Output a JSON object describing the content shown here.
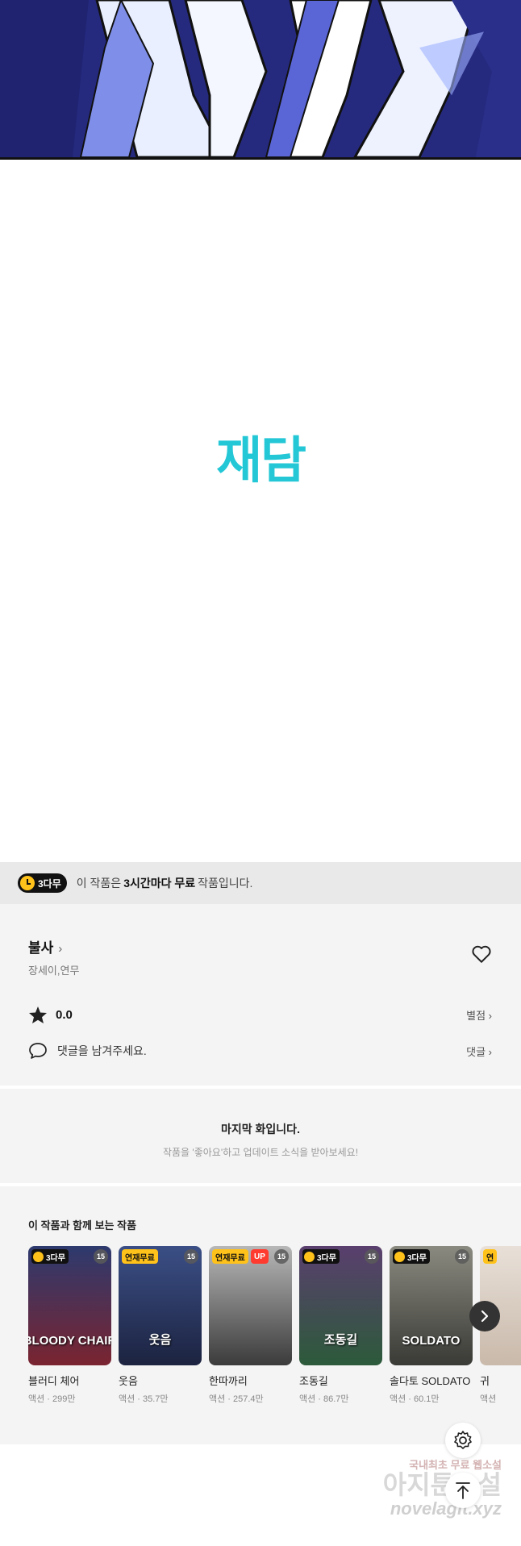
{
  "logo": {
    "text": "재담"
  },
  "free_bar": {
    "badge": "3다무",
    "text_pre": "이 작품은",
    "text_bold": "3시간마다 무료",
    "text_post": "작품입니다."
  },
  "work": {
    "title": "불사",
    "title_chevron": "›",
    "authors": "장세이,연무",
    "rating": "0.0",
    "rating_link": "별점 ›",
    "comment_placeholder": "댓글을 남겨주세요.",
    "comment_link": "댓글 ›"
  },
  "last_episode": {
    "heading": "마지막 화입니다.",
    "subtext": "작품을 '좋아요'하고 업데이트 소식을 받아보세요!"
  },
  "recommendations": {
    "title": "이 작품과 함께 보는 작품",
    "items": [
      {
        "name": "블러디 체어",
        "meta": "액션 · 299만",
        "tag": "3다무",
        "age": "15",
        "art": "BLOODY CHAIR",
        "color_top": "#2d3a6e",
        "color_bottom": "#7a2430"
      },
      {
        "name": "웃음",
        "meta": "액션 · 35.7만",
        "tag": "연재무료",
        "age": "15",
        "art": "웃음",
        "color_top": "#3b4f86",
        "color_bottom": "#1c2340"
      },
      {
        "name": "한따까리",
        "meta": "액션 · 257.4만",
        "tag": "연재무료",
        "tag2": "UP",
        "age": "15",
        "art": "",
        "color_top": "#b7b7b7",
        "color_bottom": "#3b3b3b"
      },
      {
        "name": "조동길",
        "meta": "액션 · 86.7만",
        "tag": "3다무",
        "age": "15",
        "art": "조동길",
        "color_top": "#5a3f6e",
        "color_bottom": "#2c5a3a"
      },
      {
        "name": "솔다토 SOLDATO",
        "meta": "액션 · 60.1만",
        "tag": "3다무",
        "age": "15",
        "art": "SOLDATO",
        "color_top": "#8a8a80",
        "color_bottom": "#3a3a36"
      },
      {
        "name": "귀",
        "meta": "액션",
        "tag": "연",
        "age": "",
        "art": "",
        "color_top": "#e8e0d8",
        "color_bottom": "#c9b9aa"
      }
    ]
  },
  "watermark": {
    "line1": "국내최초 무료 웹소설",
    "line2": "아지툰소설",
    "line3": "novelagit.xyz"
  },
  "colors": {
    "brand": "#23c7d6",
    "free_badge": "#ffc21a",
    "up_badge": "#ff3b30"
  }
}
